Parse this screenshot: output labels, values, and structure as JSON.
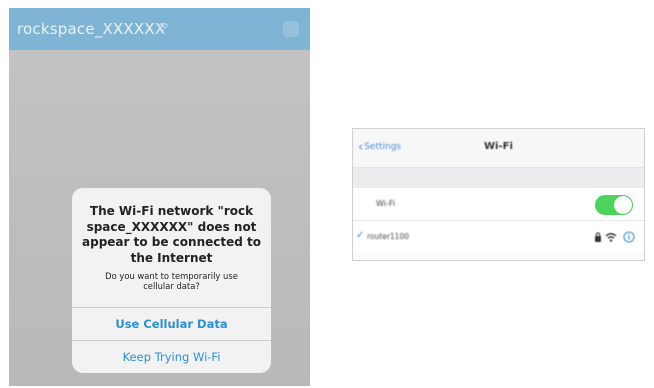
{
  "phone": {
    "ssid": "rockspace_XXXXXX",
    "alert": {
      "title": "The Wi-Fi network \"rock\nspace_XXXXXX\" does not\nappear to be connected to\nthe Internet",
      "message": "Do you want to temporarily use\ncellular data?",
      "primary_button": "Use Cellular Data",
      "secondary_button": "Keep Trying Wi-Fi"
    }
  },
  "settings": {
    "back_label": "Settings",
    "title": "Wi-Fi",
    "wifi_row_label": "Wi-Fi",
    "wifi_enabled": true,
    "network_name": "router1100"
  },
  "colors": {
    "header_blue": "#7fb4d4",
    "ios_link_blue": "#2b8fd6",
    "toggle_green": "#4cd45c"
  }
}
